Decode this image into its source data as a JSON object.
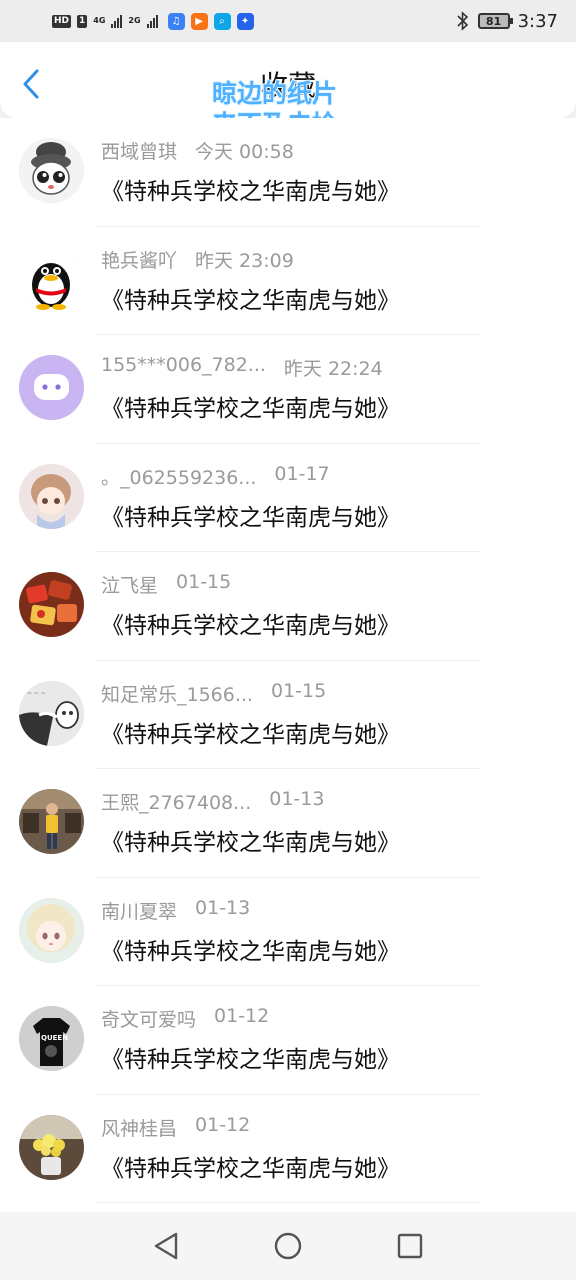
{
  "status_bar": {
    "hd_label": "HD",
    "sim_label": "1",
    "net1": "4G",
    "net2": "2G",
    "battery": "81",
    "time": "3:37",
    "app_icons": [
      {
        "name": "music-app-icon",
        "color": "#3b82f6",
        "glyph": "♫"
      },
      {
        "name": "video-app-icon",
        "color": "#f97316",
        "glyph": "▶"
      },
      {
        "name": "search-app-icon",
        "color": "#0ea5e9",
        "glyph": "⌕"
      },
      {
        "name": "bulb-app-icon",
        "color": "#2563eb",
        "glyph": "✦"
      }
    ]
  },
  "header": {
    "title": "收藏",
    "back_icon": "back-arrow-icon"
  },
  "watermark": {
    "line1": "晾边的纸片",
    "line2": "来不及去捡"
  },
  "colors": {
    "accent": "#2f8fe8",
    "meta_text": "#9a9a9a",
    "watermark": "#4fb1ff"
  },
  "items": [
    {
      "name": "西域曾琪",
      "time": "今天 00:58",
      "content": "《特种兵学校之华南虎与她》",
      "avatar": "cartoon-girl"
    },
    {
      "name": "艳兵酱吖",
      "time": "昨天 23:09",
      "content": "《特种兵学校之华南虎与她》",
      "avatar": "penguin"
    },
    {
      "name": "155***006_782...",
      "time": "昨天 22:24",
      "content": "《特种兵学校之华南虎与她》",
      "avatar": "chat-bubble"
    },
    {
      "name": "。_062559236...",
      "time": "01-17",
      "content": "《特种兵学校之华南虎与她》",
      "avatar": "anime-girl"
    },
    {
      "name": "泣飞星",
      "time": "01-15",
      "content": "《特种兵学校之华南虎与她》",
      "avatar": "food"
    },
    {
      "name": "知足常乐_1566...",
      "time": "01-15",
      "content": "《特种兵学校之华南虎与她》",
      "avatar": "sketch"
    },
    {
      "name": "王熙_2767408...",
      "time": "01-13",
      "content": "《特种兵学校之华南虎与她》",
      "avatar": "person-photo"
    },
    {
      "name": "南川夏翠",
      "time": "01-13",
      "content": "《特种兵学校之华南虎与她》",
      "avatar": "anime-blonde"
    },
    {
      "name": "奇文可爱吗",
      "time": "01-12",
      "content": "《特种兵学校之华南虎与她》",
      "avatar": "black-shirt"
    },
    {
      "name": "风神桂昌",
      "time": "01-12",
      "content": "《特种兵学校之华南虎与她》",
      "avatar": "flowers"
    }
  ]
}
